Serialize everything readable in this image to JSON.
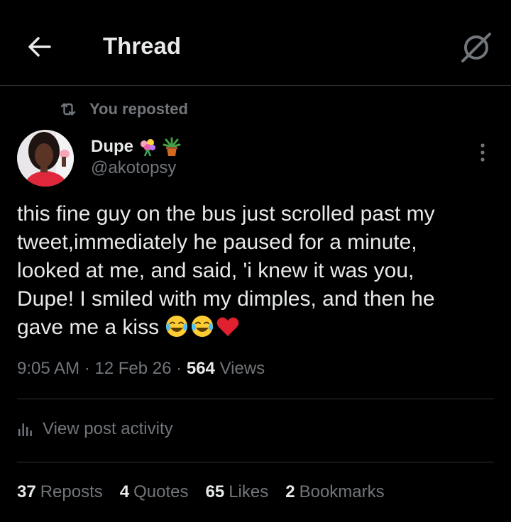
{
  "header": {
    "title": "Thread",
    "back_icon": "arrow-left-icon",
    "grok_icon": "grok-icon"
  },
  "repost": {
    "text": "You reposted",
    "icon": "repost-icon"
  },
  "author": {
    "name": "Dupe",
    "name_emojis": [
      "flower-bouquet-emoji",
      "potted-plant-emoji"
    ],
    "handle": "@akotopsy"
  },
  "tweet": {
    "lines": [
      "this fine guy on the bus just scrolled past my",
      "tweet,immediately he paused for a minute,",
      "looked at me, and said, 'i knew it was you,",
      "Dupe! I smiled with my dimples, and then he",
      "gave me a kiss"
    ],
    "trailing_emojis": [
      "tears-of-joy-emoji",
      "tears-of-joy-emoji",
      "red-heart-emoji"
    ]
  },
  "meta": {
    "time": "9:05 AM",
    "sep1": "·",
    "date": "12 Feb 26",
    "sep2": "·",
    "views_count": "564",
    "views_label": "Views"
  },
  "activity": {
    "label": "View post activity",
    "icon": "bar-chart-icon"
  },
  "stats": [
    {
      "num": "37",
      "label": "Reposts"
    },
    {
      "num": "4",
      "label": "Quotes"
    },
    {
      "num": "65",
      "label": "Likes"
    },
    {
      "num": "2",
      "label": "Bookmarks"
    }
  ],
  "colors": {
    "background": "#000000",
    "text_primary": "#e7e9ea",
    "text_secondary": "#71767b",
    "divider": "#2f3336"
  }
}
